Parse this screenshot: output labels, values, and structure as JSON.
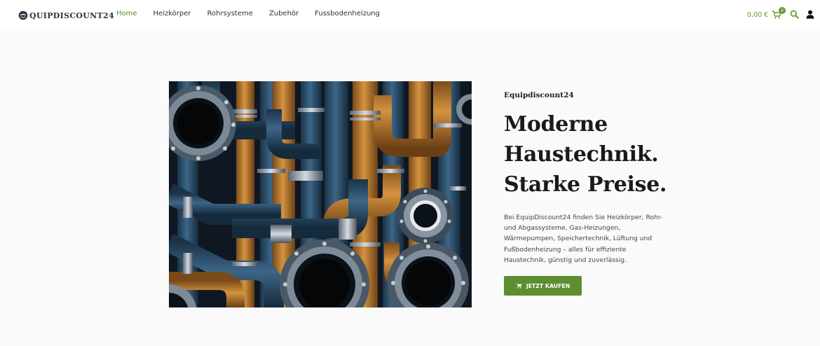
{
  "header": {
    "logo_text": "QUIPDISCOUNT24",
    "nav": [
      {
        "label": "Home",
        "active": true
      },
      {
        "label": "Heizkörper",
        "active": false
      },
      {
        "label": "Rohrsysteme",
        "active": false
      },
      {
        "label": "Zubehör",
        "active": false
      },
      {
        "label": "Fussbodenheizung",
        "active": false
      }
    ],
    "cart_total": "0,00 €",
    "cart_count": "0"
  },
  "hero": {
    "eyebrow": "Equipdiscount24",
    "headline_lines": [
      "Moderne",
      "Haustechnik.",
      "Starke Preise."
    ],
    "description_lines": [
      "Bei EquipDiscount24 finden Sie Heizkörper, Rohr-",
      "und Abgassysteme, Gas-Heizungen,",
      "Wärmepumpen, Speichertechnik, Lüftung und",
      "Fußbodenheizung – alles für effiziente",
      "Haustechnik, günstig und zuverlässig."
    ],
    "cta_label": "JETZT KAUFEN"
  },
  "colors": {
    "accent": "#5d8e2f",
    "nav_active": "#5e8e2e",
    "pipe_blue": "#2e4f6b",
    "pipe_orange": "#c0813a"
  }
}
